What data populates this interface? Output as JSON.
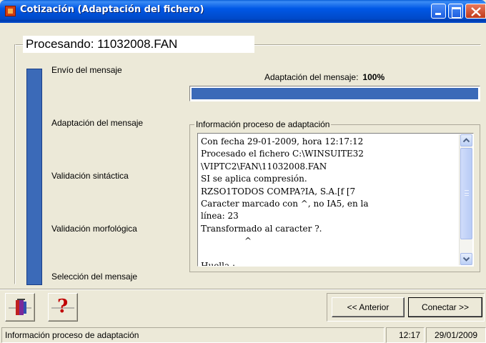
{
  "window": {
    "title": "Cotización (Adaptación del fichero)",
    "controls": {
      "minimize": "minimize",
      "maximize": "maximize",
      "close": "close"
    }
  },
  "processing": {
    "title": "Procesando: 11032008.FAN"
  },
  "steps": [
    "Envío del mensaje",
    "Adaptación del mensaje",
    "Validación sintáctica",
    "Validación morfológica",
    "Selección del mensaje"
  ],
  "adaptation": {
    "label": "Adaptación del mensaje:",
    "percent_text": "100%",
    "progress": 1.0
  },
  "info": {
    "legend": "Información proceso de adaptación",
    "lines": [
      "Con fecha 29-01-2009, hora 12:17:12",
      "Procesado el fichero C:\\WINSUITE32",
      "\\VIPTC2\\FAN\\11032008.FAN",
      "SI se aplica compresión.",
      "RZSO1TODOS COMPA?IA, S.A.[f [7",
      "Caracter marcado con ^, no IA5, en la",
      "línea: 23",
      "Transformado al caracter ?.",
      "                ^",
      "",
      "Huella :"
    ]
  },
  "toolbar": {
    "exit_icon": "door-exit-icon",
    "help_icon": "help-question-icon",
    "help_glyph": "?"
  },
  "nav": {
    "prev_label": "<< Anterior",
    "next_label": "Conectar >>"
  },
  "status": {
    "message": "Información proceso de adaptación",
    "time": "12:17",
    "date": "29/01/2009"
  },
  "colors": {
    "accent": "#3b6ab8",
    "titlebar": "#0058e6",
    "window_bg": "#ece9d8"
  }
}
